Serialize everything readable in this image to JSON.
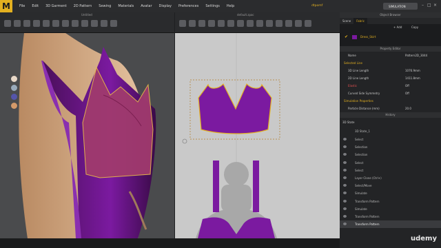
{
  "app": {
    "logo": "M",
    "user": "dtpomf",
    "sim_label": "SIMULATION"
  },
  "menu": [
    "File",
    "Edit",
    "3D Garment",
    "2D Pattern",
    "Sewing",
    "Materials",
    "Avatar",
    "Display",
    "Preferences",
    "Settings",
    "Help"
  ],
  "views": {
    "left_title": "Untitled",
    "center_title": "default.zpac"
  },
  "right_panel": {
    "object_browser": "Object Browser",
    "tabs": [
      "Scene",
      "Fabric"
    ],
    "add_label": "+ Add",
    "copy_label": "Copy",
    "fabric_name": "Dress_Skirt",
    "property_editor": "Property Editor",
    "name_label": "Name",
    "name_value": "Pattern2D_3044",
    "selected_line": "Selected Line",
    "rows": [
      {
        "label": "3D Line Length",
        "value": "1076.9mm"
      },
      {
        "label": "2D Line Length",
        "value": "1411.8mm"
      },
      {
        "label": "Elastic",
        "value": "Off"
      },
      {
        "label": "Curved Side Symmetry",
        "value": "Off"
      }
    ],
    "simulation_properties": "Simulation Properties",
    "particle_distance_label": "Particle Distance (mm)",
    "particle_distance_value": "20.0",
    "history_title": "History",
    "state_title": "3D State",
    "state_name": "3D State_1",
    "history": [
      "Select",
      "Selection",
      "Selection",
      "Select",
      "Select",
      "Layer Clone (Ctrl+)",
      "Select/Move",
      "Simulate",
      "Transform Pattern",
      "Simulate",
      "Transform Pattern",
      "Transform Pattern"
    ]
  },
  "colors": {
    "accent": "#e3b020",
    "fabric": "#7b1aa0",
    "fabric_light": "#a03a6e"
  },
  "watermark": "udemy"
}
